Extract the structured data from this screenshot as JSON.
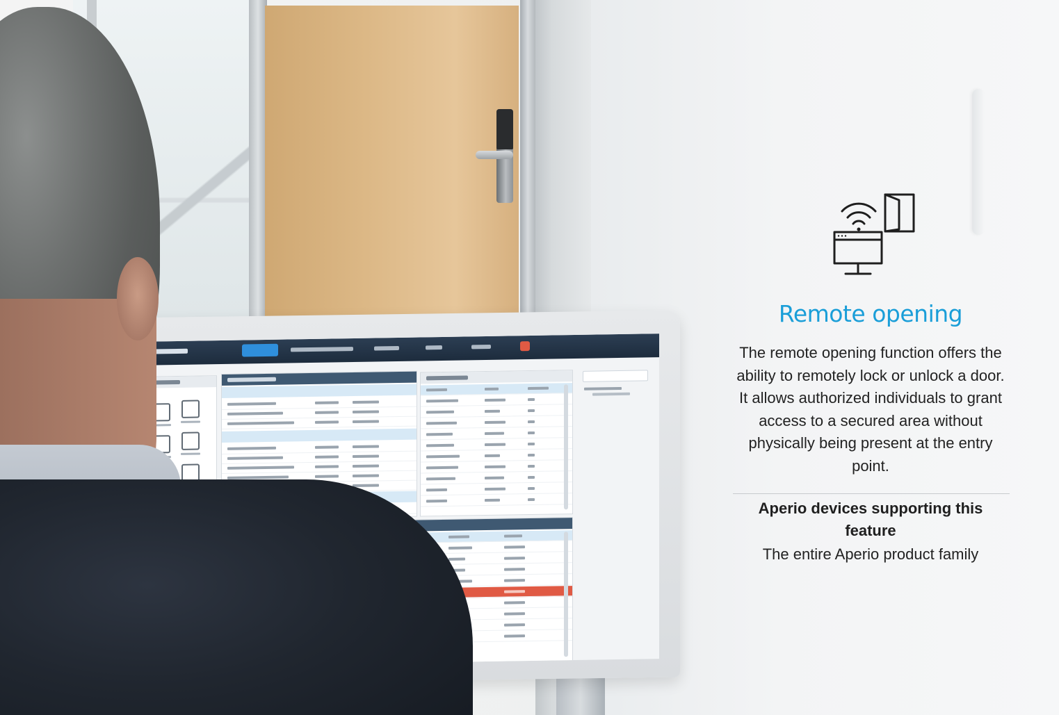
{
  "feature": {
    "icon": "remote-opening-icon",
    "title": "Remote opening",
    "description": "The remote opening function offers the ability to remotely lock or unlock a door. It allows authorized individuals to grant access to a secured area without physically being present at the entry point.",
    "support_heading": "Aperio devices supporting this feature",
    "support_value": "The entire Aperio product family",
    "accent_color": "#1a9ed8"
  },
  "scene": {
    "photo": "man-viewing-access-control-dashboard-near-door-with-electronic-lock"
  },
  "screen_colors": {
    "nav": "#1d2c3d",
    "active_tab": "#2f8fdc",
    "alert_row": "#e05a44"
  }
}
